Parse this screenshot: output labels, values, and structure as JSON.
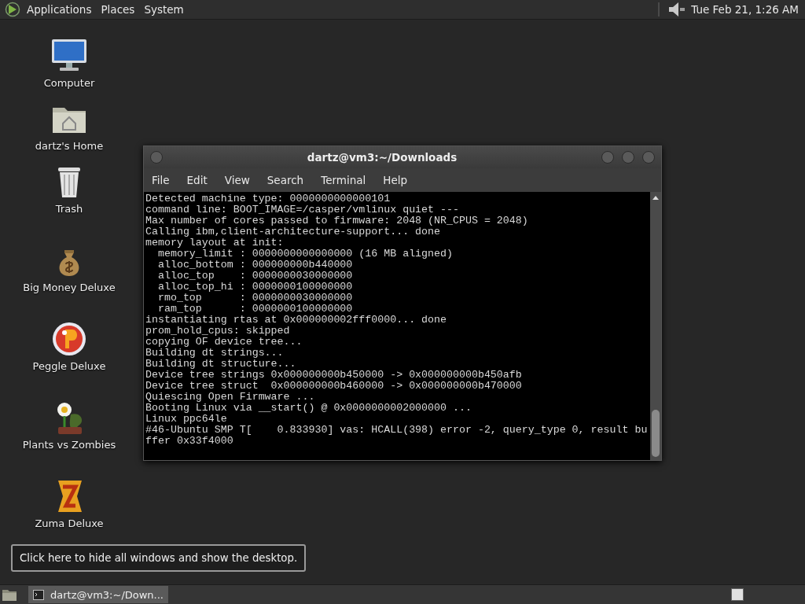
{
  "top_panel": {
    "menus": [
      "Applications",
      "Places",
      "System"
    ],
    "clock": "Tue Feb 21, 1:26 AM"
  },
  "desktop_icons": [
    {
      "label": "Computer",
      "kind": "computer"
    },
    {
      "label": "dartz's Home",
      "kind": "home"
    },
    {
      "label": "Trash",
      "kind": "trash"
    },
    {
      "label": "Big Money Deluxe",
      "kind": "money"
    },
    {
      "label": "Peggle Deluxe",
      "kind": "peggle"
    },
    {
      "label": "Plants vs Zombies",
      "kind": "plants"
    },
    {
      "label": "Zuma Deluxe",
      "kind": "zuma"
    }
  ],
  "window": {
    "title": "dartz@vm3:~/Downloads",
    "menu": [
      "File",
      "Edit",
      "View",
      "Search",
      "Terminal",
      "Help"
    ],
    "lines": [
      "Detected machine type: 0000000000000101",
      "command line: BOOT_IMAGE=/casper/vmlinux quiet ---",
      "Max number of cores passed to firmware: 2048 (NR_CPUS = 2048)",
      "Calling ibm,client-architecture-support... done",
      "memory layout at init:",
      "  memory_limit : 0000000000000000 (16 MB aligned)",
      "  alloc_bottom : 000000000b440000",
      "  alloc_top    : 0000000030000000",
      "  alloc_top_hi : 0000000100000000",
      "  rmo_top      : 0000000030000000",
      "  ram_top      : 0000000100000000",
      "instantiating rtas at 0x000000002fff0000... done",
      "prom_hold_cpus: skipped",
      "copying OF device tree...",
      "Building dt strings...",
      "Building dt structure...",
      "Device tree strings 0x000000000b450000 -> 0x000000000b450afb",
      "Device tree struct  0x000000000b460000 -> 0x000000000b470000",
      "Quiescing Open Firmware ...",
      "Booting Linux via __start() @ 0x0000000002000000 ...",
      "Linux ppc64le",
      "#46-Ubuntu SMP T[    0.833930] vas: HCALL(398) error -2, query_type 0, result bu",
      "ffer 0x33f4000"
    ]
  },
  "tooltip": "Click here to hide all windows and show the desktop.",
  "taskbar": {
    "tasks": [
      {
        "label": "dartz@vm3:~/Down...",
        "selected": true
      }
    ]
  }
}
